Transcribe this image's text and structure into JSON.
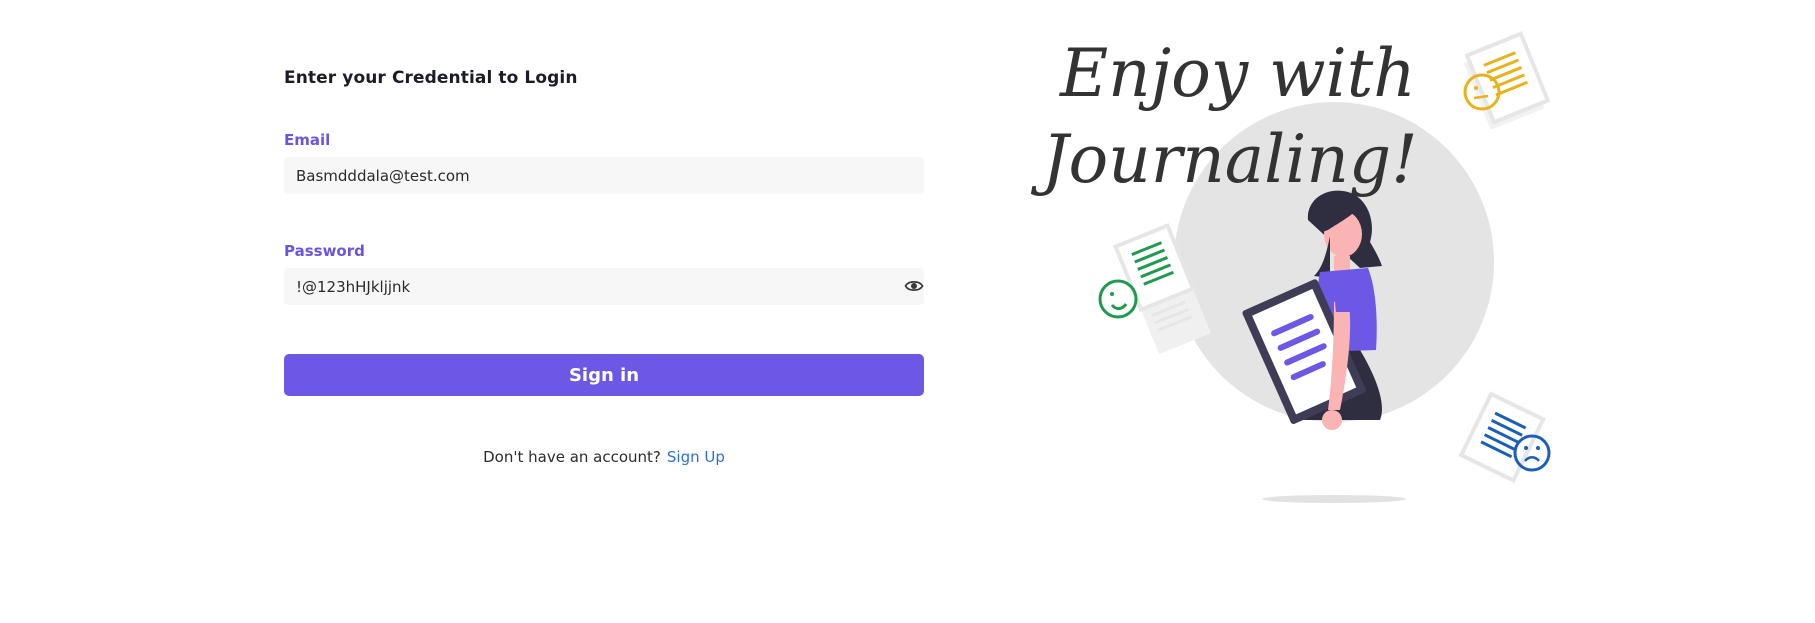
{
  "login": {
    "heading": "Enter your Credential to Login",
    "email": {
      "label": "Email",
      "value": "Basmdddala@test.com"
    },
    "password": {
      "label": "Password",
      "value": "!@123hHJkljjnk"
    },
    "submit_label": "Sign in",
    "signup_prompt": "Don't have an account?",
    "signup_link": "Sign Up"
  },
  "illustration": {
    "headline_line1": "Enjoy with",
    "headline_line2": "Journaling!"
  },
  "colors": {
    "accent": "#6c58e4",
    "label": "#6a55e0",
    "link": "#2f6fdc",
    "happy_doc": "#1f9a4f",
    "neutral_doc": "#e8b21a",
    "sad_doc": "#1c5fb8"
  },
  "icons": {
    "password_toggle": "eye-icon",
    "happy_face": "smiley-face-icon",
    "neutral_face": "neutral-face-icon",
    "sad_face": "sad-face-icon"
  }
}
